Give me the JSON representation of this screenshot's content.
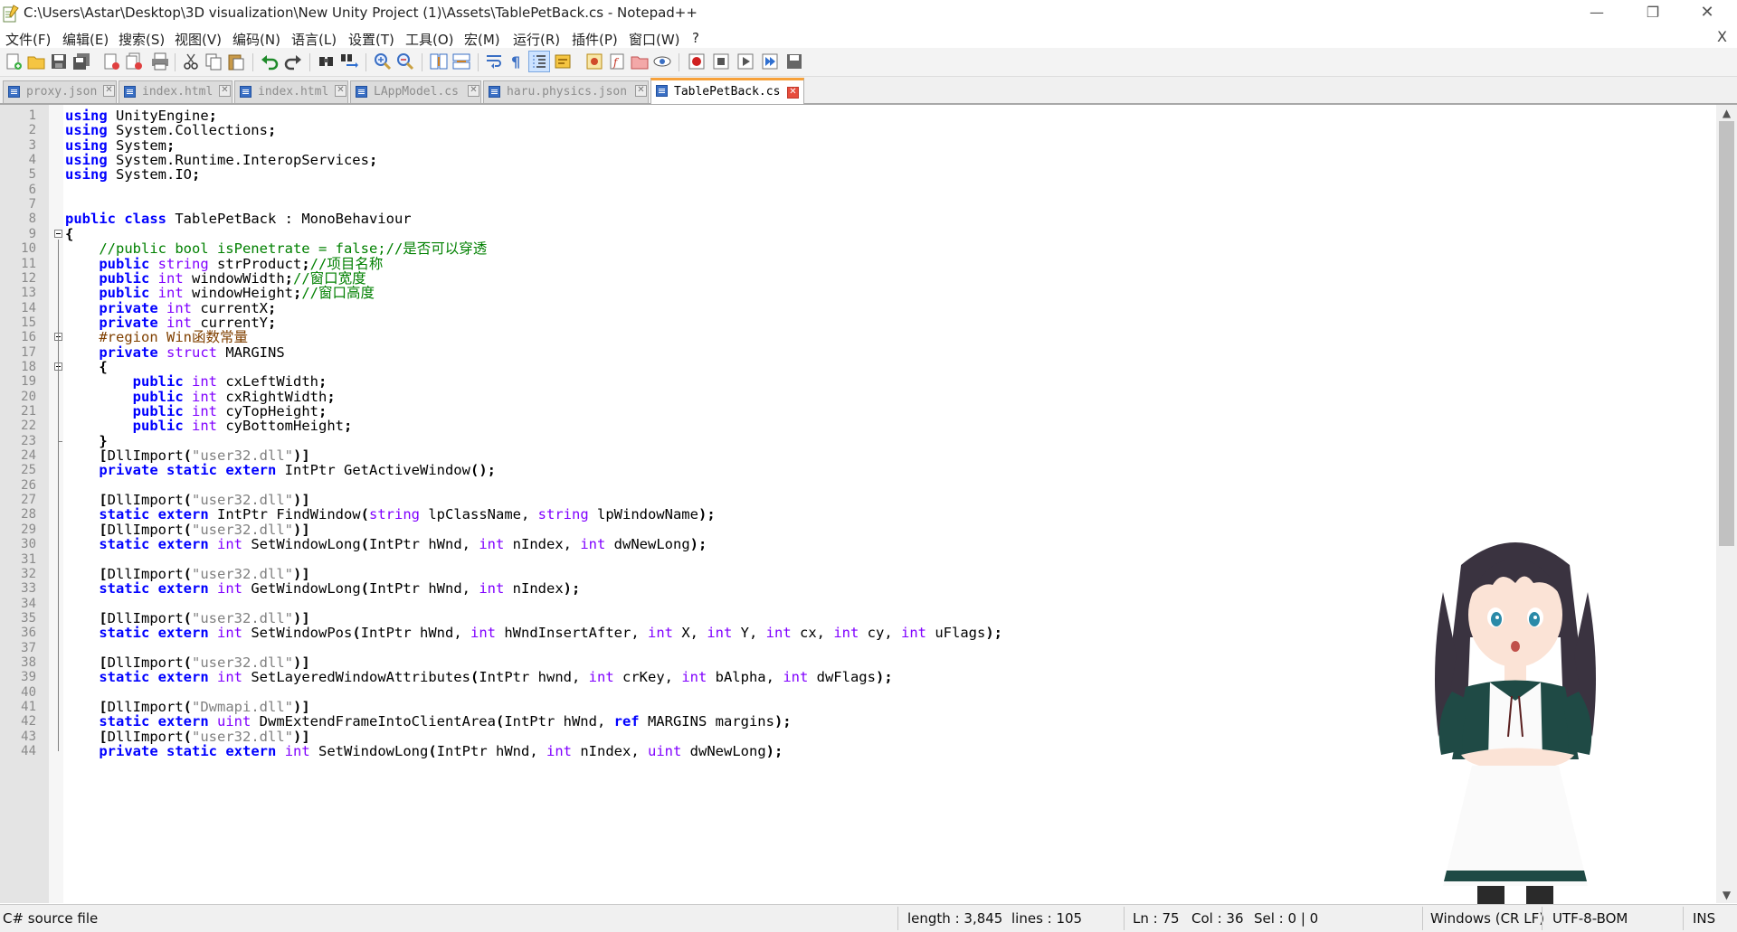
{
  "window": {
    "title": "C:\\Users\\Astar\\Desktop\\3D visualization\\New Unity Project (1)\\Assets\\TablePetBack.cs - Notepad++",
    "minimize": "—",
    "maximize": "❐",
    "close": "✕"
  },
  "menu": {
    "items": [
      "文件(F)",
      "编辑(E)",
      "搜索(S)",
      "视图(V)",
      "编码(N)",
      "语言(L)",
      "设置(T)",
      "工具(O)",
      "宏(M)",
      "运行(R)",
      "插件(P)",
      "窗口(W)",
      "?"
    ],
    "close_x": "X"
  },
  "toolbar": {
    "buttons": [
      "new-file",
      "open-file",
      "save",
      "save-all",
      "close",
      "close-all",
      "print",
      "cut",
      "copy",
      "paste",
      "undo",
      "redo",
      "find",
      "replace",
      "zoom-in",
      "zoom-out",
      "sync-vertical",
      "sync-horizontal",
      "word-wrap",
      "show-all-chars",
      "indent-guide",
      "user-defined-language",
      "document-map",
      "function-list",
      "folder-as-workspace",
      "monitoring",
      "record-macro",
      "stop-recording",
      "playback-macro",
      "run-macro-multiple",
      "save-macro"
    ]
  },
  "tabs": [
    {
      "label": "proxy.json",
      "active": false
    },
    {
      "label": "index.html",
      "active": false
    },
    {
      "label": "index.html",
      "active": false
    },
    {
      "label": "LAppModel.cs",
      "active": false
    },
    {
      "label": "haru.physics.json",
      "active": false
    },
    {
      "label": "TablePetBack.cs",
      "active": true
    }
  ],
  "editor": {
    "lines": [
      {
        "n": "1",
        "code": "using UnityEngine;"
      },
      {
        "n": "2",
        "code": "using System.Collections;"
      },
      {
        "n": "3",
        "code": "using System;"
      },
      {
        "n": "4",
        "code": "using System.Runtime.InteropServices;"
      },
      {
        "n": "5",
        "code": "using System.IO;"
      },
      {
        "n": "6",
        "code": ""
      },
      {
        "n": "7",
        "code": ""
      },
      {
        "n": "8",
        "code": "public class TablePetBack : MonoBehaviour"
      },
      {
        "n": "9",
        "code": "{"
      },
      {
        "n": "10",
        "code": "    //public bool isPenetrate = false;//是否可以穿透"
      },
      {
        "n": "11",
        "code": "    public string strProduct;//项目名称"
      },
      {
        "n": "12",
        "code": "    public int windowWidth;//窗口宽度"
      },
      {
        "n": "13",
        "code": "    public int windowHeight;//窗口高度"
      },
      {
        "n": "14",
        "code": "    private int currentX;"
      },
      {
        "n": "15",
        "code": "    private int currentY;"
      },
      {
        "n": "16",
        "code": "    #region Win函数常量"
      },
      {
        "n": "17",
        "code": "    private struct MARGINS"
      },
      {
        "n": "18",
        "code": "    {"
      },
      {
        "n": "19",
        "code": "        public int cxLeftWidth;"
      },
      {
        "n": "20",
        "code": "        public int cxRightWidth;"
      },
      {
        "n": "21",
        "code": "        public int cyTopHeight;"
      },
      {
        "n": "22",
        "code": "        public int cyBottomHeight;"
      },
      {
        "n": "23",
        "code": "    }"
      },
      {
        "n": "24",
        "code": "    [DllImport(\"user32.dll\")]"
      },
      {
        "n": "25",
        "code": "    private static extern IntPtr GetActiveWindow();"
      },
      {
        "n": "26",
        "code": ""
      },
      {
        "n": "27",
        "code": "    [DllImport(\"user32.dll\")]"
      },
      {
        "n": "28",
        "code": "    static extern IntPtr FindWindow(string lpClassName, string lpWindowName);"
      },
      {
        "n": "29",
        "code": "    [DllImport(\"user32.dll\")]"
      },
      {
        "n": "30",
        "code": "    static extern int SetWindowLong(IntPtr hWnd, int nIndex, int dwNewLong);"
      },
      {
        "n": "31",
        "code": ""
      },
      {
        "n": "32",
        "code": "    [DllImport(\"user32.dll\")]"
      },
      {
        "n": "33",
        "code": "    static extern int GetWindowLong(IntPtr hWnd, int nIndex);"
      },
      {
        "n": "34",
        "code": ""
      },
      {
        "n": "35",
        "code": "    [DllImport(\"user32.dll\")]"
      },
      {
        "n": "36",
        "code": "    static extern int SetWindowPos(IntPtr hWnd, int hWndInsertAfter, int X, int Y, int cx, int cy, int uFlags);"
      },
      {
        "n": "37",
        "code": ""
      },
      {
        "n": "38",
        "code": "    [DllImport(\"user32.dll\")]"
      },
      {
        "n": "39",
        "code": "    static extern int SetLayeredWindowAttributes(IntPtr hwnd, int crKey, int bAlpha, int dwFlags);"
      },
      {
        "n": "40",
        "code": ""
      },
      {
        "n": "41",
        "code": "    [DllImport(\"Dwmapi.dll\")]"
      },
      {
        "n": "42",
        "code": "    static extern uint DwmExtendFrameIntoClientArea(IntPtr hWnd, ref MARGINS margins);"
      },
      {
        "n": "43",
        "code": "    [DllImport(\"user32.dll\")]"
      },
      {
        "n": "44",
        "code": "    private static extern int SetWindowLong(IntPtr hWnd, int nIndex, uint dwNewLong);"
      }
    ],
    "fold_markers": [
      9,
      16,
      18
    ]
  },
  "statusbar": {
    "file_type": "C# source file",
    "length": "length : 3,845",
    "lines": "lines : 105",
    "ln": "Ln : 75",
    "col": "Col : 36",
    "sel": "Sel : 0 | 0",
    "eol": "Windows (CR LF)",
    "encoding": "UTF-8-BOM",
    "mode": "INS"
  },
  "colors": {
    "keyword": "#0000ff",
    "type": "#8000ff",
    "comment": "#008000",
    "preprocessor": "#804000",
    "string": "#808080",
    "active_tab_accent": "#f7a13a"
  }
}
